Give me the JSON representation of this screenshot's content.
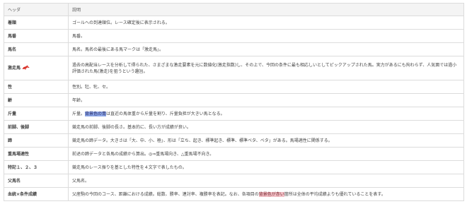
{
  "table": {
    "headers": {
      "key": "ヘッダ",
      "desc": "説明"
    },
    "rows": [
      {
        "key": "着順",
        "desc": "ゴールへの到達順位。レース確定後に表示される。"
      },
      {
        "key": "馬番",
        "desc": "馬番。"
      },
      {
        "key": "馬名",
        "desc": "馬名。馬名の最後にある馬マークは「激走馬」。"
      },
      {
        "key": "激走馬",
        "desc": "過去の高配当レースを分析して得られた、さまざまな激走要素を元に数値化(激走指数)し、その上で、今回の条件に最も相応しいとしてピックアップされた馬。実力があるにも拘わらず、人気面では過小評価された馬(激走)を狙うという趣旨。",
        "icon": "horse-icon",
        "icon_color": "#d9342b"
      },
      {
        "key": "性",
        "desc": "性別。牡、牝、セ。"
      },
      {
        "key": "齢",
        "desc": "年齢。"
      },
      {
        "key": "斤量",
        "desc_pre": "斤量。",
        "desc_hl": "背景色の青",
        "desc_post": "は直近の馬体重から斤量を割り、斤量負担が大きい馬となる。",
        "hl_color": "#8fa8e8"
      },
      {
        "key": "前脚、後脚",
        "desc": "競走馬の前脚、後脚の長さ。基本的に、長い方が成績が良い。"
      },
      {
        "key": "蹄",
        "desc": "競走馬の蹄データ。大きさは「大、中、小、極」、形は「立ち、起き、標準起き、標準、標準ベタ、ベタ」がある。馬場適性に関係する。"
      },
      {
        "key": "重馬場適性",
        "desc": "前述の蹄データと各馬の成績から算出。◎⇒重馬場向き、△重馬場不向き。"
      },
      {
        "key": "特記１、２、３",
        "desc": "競走馬のレース振りを基とした特性を４文字で表したもの。"
      },
      {
        "key": "父馬名",
        "desc": "父馬名。"
      },
      {
        "key": "血統×条件成績",
        "desc_pre": "父産駒の今回のコース、距離における成績。総数、勝率、連対率、複勝率を表記。なお、各項目の",
        "desc_hl": "背景色が赤い",
        "desc_post": "箇所は全体の平均成績よりも優れていることを表す。",
        "hl_color": "#f2c0c6"
      }
    ]
  }
}
